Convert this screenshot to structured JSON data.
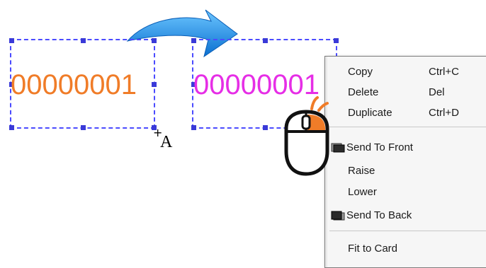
{
  "canvas": {
    "barcode_left": {
      "text": "00000001",
      "color": "#f07c28"
    },
    "barcode_right": {
      "text": "00000001",
      "color": "#e62ee6"
    },
    "text_tool_cursor_label": "A",
    "selection_color": "#4b4bff",
    "arrow_color": "#1e8ee8"
  },
  "context_menu": {
    "items": [
      {
        "label": "Copy",
        "shortcut": "Ctrl+C"
      },
      {
        "label": "Delete",
        "shortcut": "Del"
      },
      {
        "label": "Duplicate",
        "shortcut": "Ctrl+D"
      },
      {
        "label": "Send To Front",
        "icon": "send-to-front-icon"
      },
      {
        "label": "Raise"
      },
      {
        "label": "Lower"
      },
      {
        "label": "Send To Back",
        "icon": "send-to-back-icon"
      },
      {
        "label": "Fit to Card"
      }
    ]
  },
  "mouse": {
    "icon": "mouse-right-click-icon",
    "button_color": "#f07c28"
  }
}
